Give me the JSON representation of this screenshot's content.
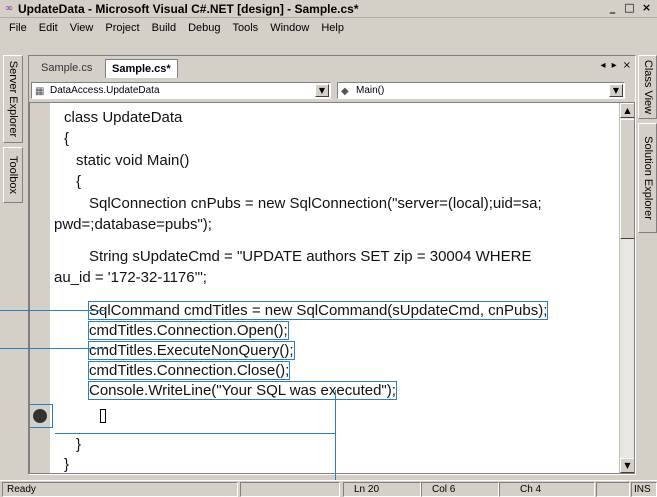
{
  "window": {
    "title": "UpdateData - Microsoft Visual C#.NET [design] - Sample.cs*",
    "controls": [
      "_",
      "□",
      "×"
    ]
  },
  "menu": {
    "items": [
      "File",
      "Edit",
      "View",
      "Project",
      "Build",
      "Debug",
      "Tools",
      "Window",
      "Help"
    ]
  },
  "side_tabs": {
    "left": [
      "Server Explorer",
      "Toolbox"
    ],
    "right": [
      "Class View",
      "Solution Explorer"
    ]
  },
  "doc_tabs": {
    "tabs": [
      "Sample.cs",
      "Sample.cs*"
    ],
    "nav": [
      "◂",
      "▸",
      "×"
    ]
  },
  "dropdowns": {
    "type_selector": "DataAccess.UpdateData",
    "member_selector": "Main()"
  },
  "code": {
    "lines": [
      "class UpdateData",
      "{",
      "static void Main()",
      "{",
      "SqlConnection cnPubs = new SqlConnection(\"server=(local);uid=sa;",
      "pwd=;database=pubs\");",
      "String sUpdateCmd = \"UPDATE authors SET zip = 30004 WHERE",
      "au_id = '172-32-1176'\";",
      "SqlCommand cmdTitles = new SqlCommand(sUpdateCmd, cnPubs);",
      "cmdTitles.Connection.Open();",
      "cmdTitles.ExecuteNonQuery();",
      "cmdTitles.Connection.Close();",
      "Console.WriteLine(\"Your SQL was executed\");",
      "}",
      "}"
    ]
  },
  "status": {
    "ready": "Ready",
    "line": "Ln 20",
    "col": "Col 6",
    "ch": "Ch 4",
    "ins": "INS"
  },
  "colors": {
    "chrome": "#d4d0c8",
    "highlight_outline": "#2e7fc0",
    "keyword": "#1e2a88"
  }
}
